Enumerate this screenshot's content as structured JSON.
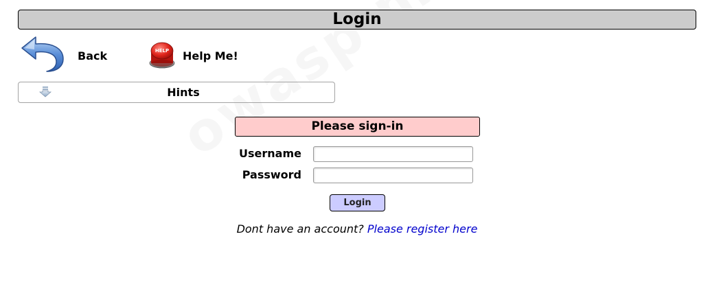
{
  "page": {
    "title": "Login"
  },
  "nav": {
    "back_label": "Back",
    "help_label": "Help Me!",
    "help_icon_text": "HELP"
  },
  "hints": {
    "label": "Hints"
  },
  "signin": {
    "header": "Please sign-in",
    "username_label": "Username",
    "password_label": "Password",
    "username_value": "",
    "password_value": "",
    "login_button": "Login",
    "no_account_text": "Dont have an account?",
    "register_link": "Please register here"
  },
  "colors": {
    "title_bar_bg": "#cccccc",
    "signin_header_bg": "#ffcccc",
    "login_button_bg": "#ccccff",
    "link_color": "#0000cc"
  },
  "icons": {
    "back": "back-arrow-icon",
    "help": "help-button-icon",
    "hints": "expand-arrow-icon"
  }
}
